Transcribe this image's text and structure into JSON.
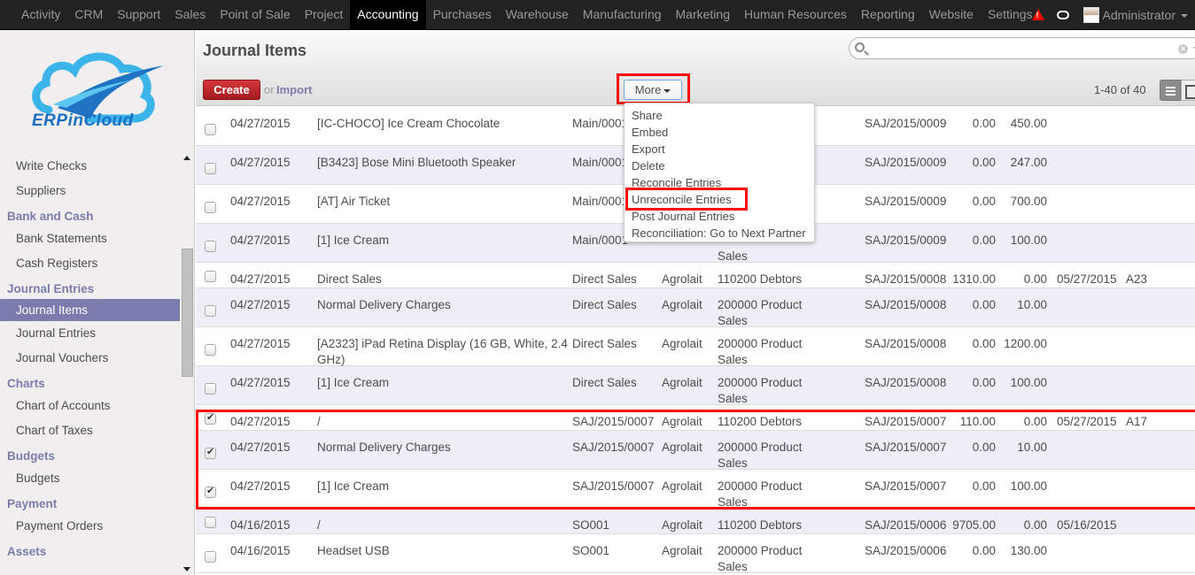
{
  "topbar": {
    "menu": [
      "Activity",
      "CRM",
      "Support",
      "Sales",
      "Point of Sale",
      "Project",
      "Accounting",
      "Purchases",
      "Warehouse",
      "Manufacturing",
      "Marketing",
      "Human Resources",
      "Reporting",
      "Website",
      "Settings"
    ],
    "active": "Accounting",
    "user": "Administrator",
    "icons": [
      "warning-icon",
      "chat-icon"
    ]
  },
  "logo": {
    "text": "ERPinCloud"
  },
  "sidebar": {
    "items": [
      {
        "type": "link",
        "label": "Write Checks"
      },
      {
        "type": "link",
        "label": "Suppliers"
      },
      {
        "type": "section",
        "label": "Bank and Cash"
      },
      {
        "type": "link",
        "label": "Bank Statements"
      },
      {
        "type": "link",
        "label": "Cash Registers"
      },
      {
        "type": "section",
        "label": "Journal Entries"
      },
      {
        "type": "link",
        "label": "Journal Items",
        "active": true
      },
      {
        "type": "link",
        "label": "Journal Entries"
      },
      {
        "type": "link",
        "label": "Journal Vouchers"
      },
      {
        "type": "section",
        "label": "Charts"
      },
      {
        "type": "link",
        "label": "Chart of Accounts"
      },
      {
        "type": "link",
        "label": "Chart of Taxes"
      },
      {
        "type": "section",
        "label": "Budgets"
      },
      {
        "type": "link",
        "label": "Budgets"
      },
      {
        "type": "section",
        "label": "Payment"
      },
      {
        "type": "link",
        "label": "Payment Orders"
      },
      {
        "type": "section",
        "label": "Assets"
      }
    ]
  },
  "header": {
    "title": "Journal Items",
    "create_label": "Create",
    "or_label": "or",
    "import_label": "Import",
    "more_label": "More",
    "pager": "1-40 of 40",
    "search_value": "",
    "search_placeholder": ""
  },
  "more_menu": {
    "items": [
      "Share",
      "Embed",
      "Export",
      "Delete",
      "Reconcile Entries",
      "Unreconcile Entries",
      "Post Journal Entries",
      "Reconciliation: Go to Next Partner"
    ],
    "highlighted": "Unreconcile Entries"
  },
  "colors": {
    "accent": "#7c7bad",
    "create": "#c0282d",
    "highlight": "#ff0000",
    "topbar": "#222222"
  },
  "rows": [
    {
      "checked": false,
      "date": "04/27/2015",
      "name": "[IC-CHOCO] Ice Cream Chocolate",
      "ref": "Main/0001",
      "partner": "",
      "account": "",
      "move": "SAJ/2015/0009",
      "debit": "0.00",
      "credit": "450.00",
      "maturity": "",
      "reconcile": ""
    },
    {
      "checked": false,
      "date": "04/27/2015",
      "name": "[B3423] Bose Mini Bluetooth Speaker",
      "ref": "Main/0001",
      "partner": "",
      "account": "",
      "move": "SAJ/2015/0009",
      "debit": "0.00",
      "credit": "247.00",
      "maturity": "",
      "reconcile": ""
    },
    {
      "checked": false,
      "date": "04/27/2015",
      "name": "[AT] Air Ticket",
      "ref": "Main/0001",
      "partner": "",
      "account": "",
      "move": "SAJ/2015/0009",
      "debit": "0.00",
      "credit": "700.00",
      "maturity": "",
      "reconcile": ""
    },
    {
      "checked": false,
      "date": "04/27/2015",
      "name": "[1] Ice Cream",
      "ref": "Main/0001",
      "partner": "",
      "account": "Sales",
      "move": "SAJ/2015/0009",
      "debit": "0.00",
      "credit": "100.00",
      "maturity": "",
      "reconcile": ""
    },
    {
      "checked": false,
      "date": "04/27/2015",
      "name": "Direct Sales",
      "ref": "Direct Sales",
      "partner": "Agrolait",
      "account": "110200 Debtors",
      "move": "SAJ/2015/0008",
      "debit": "1310.00",
      "credit": "0.00",
      "maturity": "05/27/2015",
      "reconcile": "A23"
    },
    {
      "checked": false,
      "date": "04/27/2015",
      "name": "Normal Delivery Charges",
      "ref": "Direct Sales",
      "partner": "Agrolait",
      "account": "200000 Product Sales",
      "move": "SAJ/2015/0008",
      "debit": "0.00",
      "credit": "10.00",
      "maturity": "",
      "reconcile": ""
    },
    {
      "checked": false,
      "date": "04/27/2015",
      "name": "[A2323] iPad Retina Display (16 GB, White, 2.4 GHz)",
      "ref": "Direct Sales",
      "partner": "Agrolait",
      "account": "200000 Product Sales",
      "move": "SAJ/2015/0008",
      "debit": "0.00",
      "credit": "1200.00",
      "maturity": "",
      "reconcile": ""
    },
    {
      "checked": false,
      "date": "04/27/2015",
      "name": "[1] Ice Cream",
      "ref": "Direct Sales",
      "partner": "Agrolait",
      "account": "200000 Product Sales",
      "move": "SAJ/2015/0008",
      "debit": "0.00",
      "credit": "100.00",
      "maturity": "",
      "reconcile": ""
    },
    {
      "checked": true,
      "date": "04/27/2015",
      "name": "/",
      "ref": "SAJ/2015/0007",
      "partner": "Agrolait",
      "account": "110200 Debtors",
      "move": "SAJ/2015/0007",
      "debit": "110.00",
      "credit": "0.00",
      "maturity": "05/27/2015",
      "reconcile": "A17"
    },
    {
      "checked": true,
      "date": "04/27/2015",
      "name": "Normal Delivery Charges",
      "ref": "SAJ/2015/0007",
      "partner": "Agrolait",
      "account": "200000 Product Sales",
      "move": "SAJ/2015/0007",
      "debit": "0.00",
      "credit": "10.00",
      "maturity": "",
      "reconcile": ""
    },
    {
      "checked": true,
      "date": "04/27/2015",
      "name": "[1] Ice Cream",
      "ref": "SAJ/2015/0007",
      "partner": "Agrolait",
      "account": "200000 Product Sales",
      "move": "SAJ/2015/0007",
      "debit": "0.00",
      "credit": "100.00",
      "maturity": "",
      "reconcile": ""
    },
    {
      "checked": false,
      "date": "04/16/2015",
      "name": "/",
      "ref": "SO001",
      "partner": "Agrolait",
      "account": "110200 Debtors",
      "move": "SAJ/2015/0006",
      "debit": "9705.00",
      "credit": "0.00",
      "maturity": "05/16/2015",
      "reconcile": ""
    },
    {
      "checked": false,
      "date": "04/16/2015",
      "name": "Headset USB",
      "ref": "SO001",
      "partner": "Agrolait",
      "account": "200000 Product Sales",
      "move": "SAJ/2015/0006",
      "debit": "0.00",
      "credit": "130.00",
      "maturity": "",
      "reconcile": ""
    }
  ]
}
